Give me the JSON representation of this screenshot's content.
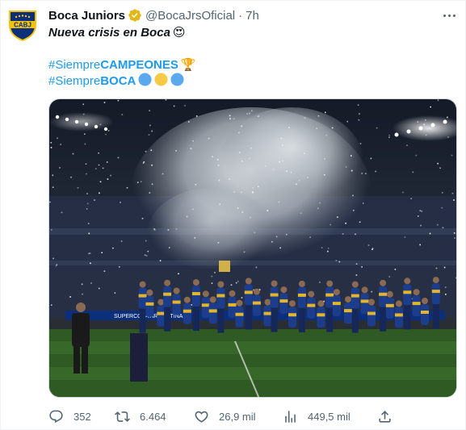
{
  "tweet": {
    "display_name": "Boca Juniors",
    "handle": "@BocaJrsOficial",
    "separator": "·",
    "time": "7h",
    "verified_icon": "verified-badge-gold",
    "avatar_text": "CABJ",
    "lines": {
      "line1": "Nueva crisis en Boca",
      "line1_emoji": "😍",
      "tag1_prefix": "#Siempre",
      "tag1_bold": "CAMPEONES",
      "tag1_emoji": "🏆",
      "tag2_prefix": "#Siempre",
      "tag2_bold": "BOCA"
    },
    "media": {
      "alt": "Boca Juniors players celebrating with trophy under confetti",
      "banner_text": "SUPERCOPA ARGENTINA"
    }
  },
  "actions": {
    "replies": "352",
    "retweets": "6.464",
    "likes": "26,9 mil",
    "views": "449,5 mil"
  },
  "colors": {
    "accent": "#1d9bf0",
    "muted": "#536471",
    "boca_blue": "#0b2f7a",
    "boca_gold": "#f4c20d",
    "circle_blue": "#5aa9ee",
    "circle_yellow": "#f7c948"
  }
}
